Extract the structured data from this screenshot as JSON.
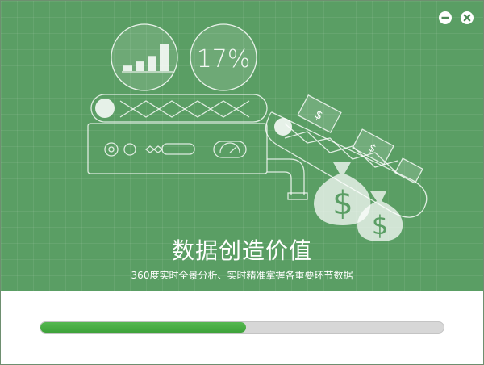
{
  "window": {
    "minimize_icon": "minus-circle-icon",
    "close_icon": "close-circle-icon"
  },
  "banner": {
    "percent_display": "17%",
    "headline": "数据创造价值",
    "subline": "360度实时全景分析、实时精准掌握各重要环节数据",
    "bar_chart_levels": [
      0.2,
      0.35,
      0.55,
      1.0
    ],
    "colors": {
      "background": "#5a9e64",
      "line": "#ffffff"
    }
  },
  "progress": {
    "fraction": 0.51,
    "fill_color": "#3ea23a",
    "track_color": "#d7d7d7"
  }
}
